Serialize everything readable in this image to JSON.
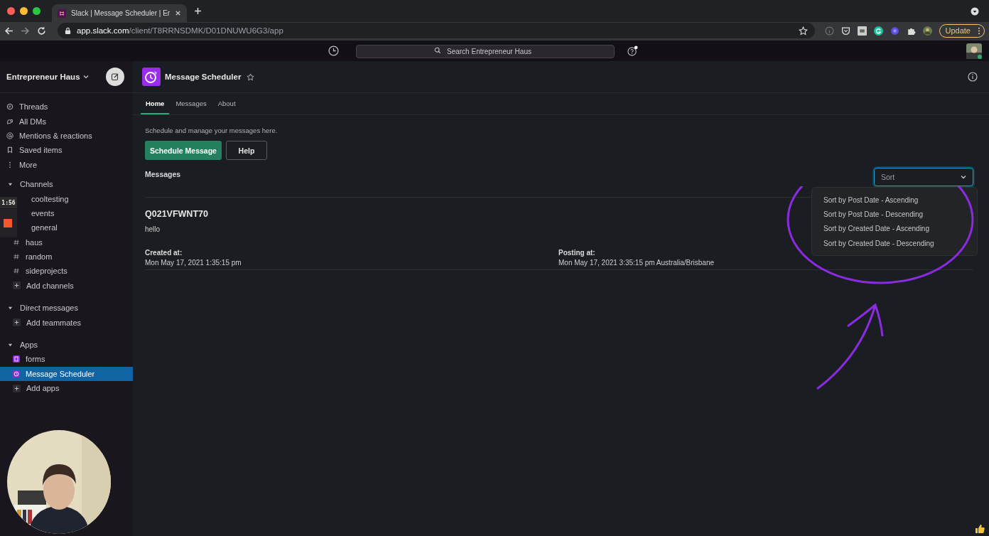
{
  "browser": {
    "tab": {
      "title": "Slack | Message Scheduler | Er",
      "selected": true
    },
    "url_host": "app.slack.com",
    "url_path": "/client/T8RRNSDMK/D01DNUWU6G3/app",
    "update_button": "Update"
  },
  "topbar": {
    "search": {
      "placeholder": "Search Entrepreneur Haus"
    }
  },
  "sidebar": {
    "workspace": "Entrepreneur Haus",
    "items": [
      {
        "kind": "threads",
        "label": "Threads",
        "selected": false
      },
      {
        "kind": "dms",
        "label": "All DMs",
        "selected": false
      },
      {
        "kind": "mentions",
        "label": "Mentions & reactions",
        "selected": false
      },
      {
        "kind": "saved",
        "label": "Saved items",
        "selected": false
      },
      {
        "kind": "more",
        "label": "More",
        "selected": false
      },
      {
        "kind": "section",
        "label": "Channels",
        "expanded": true,
        "children": [
          {
            "kind": "plain",
            "label": "cooltesting",
            "selected": false
          },
          {
            "kind": "plain",
            "label": "events",
            "selected": false
          },
          {
            "kind": "plain",
            "label": "general",
            "selected": false
          },
          {
            "kind": "channel",
            "label": "haus",
            "selected": false
          },
          {
            "kind": "channel",
            "label": "random",
            "selected": false
          },
          {
            "kind": "channel",
            "label": "sideprojects",
            "selected": false
          },
          {
            "kind": "add",
            "label": "Add channels",
            "selected": false
          }
        ]
      },
      {
        "kind": "section",
        "label": "Direct messages",
        "expanded": true,
        "children": [
          {
            "kind": "add",
            "label": "Add teammates",
            "selected": false
          }
        ]
      },
      {
        "kind": "section",
        "label": "Apps",
        "expanded": true,
        "children": [
          {
            "kind": "form-app",
            "label": "forms",
            "selected": false
          },
          {
            "kind": "clock-app",
            "label": "Message Scheduler",
            "selected": true
          },
          {
            "kind": "add",
            "label": "Add apps",
            "selected": false
          }
        ]
      }
    ]
  },
  "header": {
    "title": "Message Scheduler"
  },
  "tabs": [
    {
      "label": "Home",
      "selected": true
    },
    {
      "label": "Messages",
      "selected": false
    },
    {
      "label": "About",
      "selected": false
    }
  ],
  "intro": "Schedule and manage your messages here.",
  "buttons": [
    {
      "label": "Schedule Message",
      "kind": "primary"
    },
    {
      "label": "Help",
      "kind": "secondary"
    }
  ],
  "messages_heading": "Messages",
  "sort": {
    "placeholder": "Sort",
    "expanded": true,
    "options": [
      "Sort by Post Date - Ascending",
      "Sort by Post Date - Descending",
      "Sort by Created Date - Ascending",
      "Sort by Created Date - Descending"
    ]
  },
  "messages": [
    {
      "id": "Q021VFWNT70",
      "text": "hello",
      "created_label": "Created at:",
      "created": "Mon May 17, 2021 1:35:15 pm",
      "posting_label": "Posting at:",
      "posting": "Mon May 17, 2021 3:35:15 pm Australia/Brisbane"
    }
  ],
  "overlay": {
    "timer": "1:56"
  }
}
